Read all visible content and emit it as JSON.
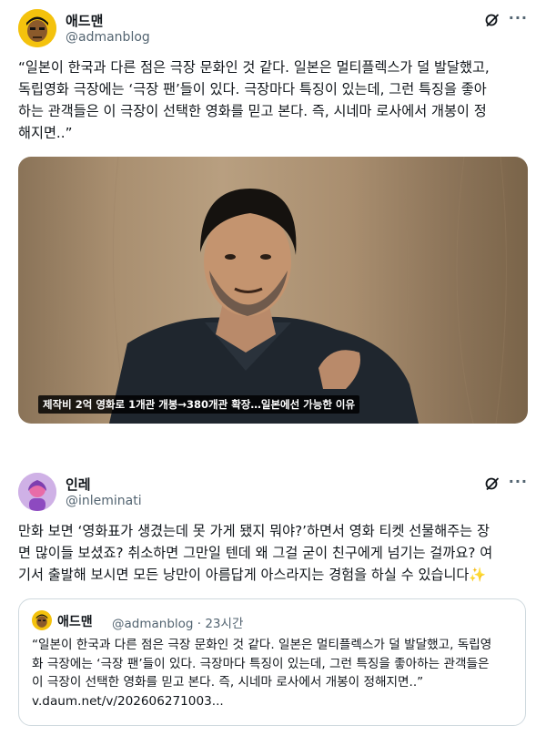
{
  "post1": {
    "display_name": "애드맨",
    "handle": "@admanblog",
    "text": "“일본이 한국과 다른 점은 극장 문화인 것 같다. 일본은 멀티플렉스가 덜 발달했고,\n독립영화 극장에는 ‘극장 팬’들이 있다. 극장마다 특징이 있는데, 그런 특징을 좋아\n하는 관객들은 이 극장이 선택한 영화를 믿고 본다. 즉, 시네마 로사에서 개봉이 정\n해지면..”",
    "media_caption": "제작비 2억 영화로 1개관 개봉→380개관 확장…일본에선 가능한 이유"
  },
  "post2": {
    "display_name": "인레",
    "handle": "@inleminati",
    "text": "만화 보면 ‘영화표가 생겼는데 못 가게 됐지 뭐야?’하면서 영화 티켓 선물해주는 장\n면 많이들 보셨죠? 취소하면 그만일 텐데 왜 그걸 굳이 친구에게 넘기는 걸까요? 여\n기서 출발해 보시면 모든 낭만이 아름답게 아스라지는 경험을 하실 수 있습니다✨",
    "quote": {
      "display_name": "애드맨",
      "handle_time": "@admanblog · 23시간",
      "text": "“일본이 한국과 다른 점은 극장 문화인 것 같다. 일본은 멀티플렉스가 덜 발달했고, 독립영\n화 극장에는 ‘극장 팬’들이 있다. 극장마다 특징이 있는데, 그런 특징을 좋아하는 관객들은\n이 극장이 선택한 영화를 믿고 본다. 즉, 시네마 로사에서 개봉이 정해지면..”\nv.daum.net/v/202606271003..."
    }
  },
  "icons": {
    "more": "···"
  },
  "colors": {
    "text": "#0f1419",
    "secondary": "#536471",
    "border": "#cfd9de"
  }
}
